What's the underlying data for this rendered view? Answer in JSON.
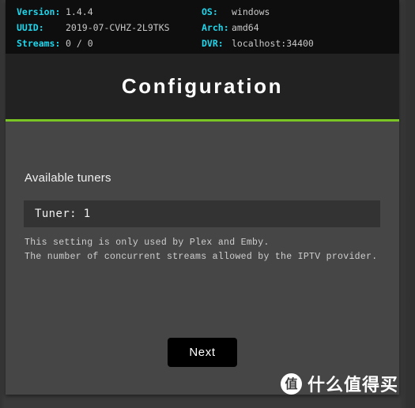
{
  "info_strip": {
    "left_column": [
      {
        "label": "Version:",
        "value": "1.4.4"
      },
      {
        "label": "UUID:",
        "value": "2019-07-CVHZ-2L9TKS"
      },
      {
        "label": "Streams:",
        "value": "0 / 0"
      }
    ],
    "right_column": [
      {
        "label": "OS:",
        "value": "windows"
      },
      {
        "label": "Arch:",
        "value": "amd64"
      },
      {
        "label": "DVR:",
        "value": "localhost:34400"
      }
    ],
    "label_color": "#1fd6ec",
    "value_color": "#c9c9c9"
  },
  "header": {
    "title": "Configuration",
    "accent_color": "#7ac424"
  },
  "main": {
    "section_label": "Available tuners",
    "tuner_field": {
      "value": "Tuner: 1",
      "placeholder": "Tuner: 1"
    },
    "helper_text": [
      "This setting is only used by Plex and Emby.",
      "The number of concurrent streams allowed by the IPTV provider."
    ],
    "next_button_label": "Next"
  },
  "watermark": {
    "badge": "值",
    "text": "什么值得买"
  }
}
